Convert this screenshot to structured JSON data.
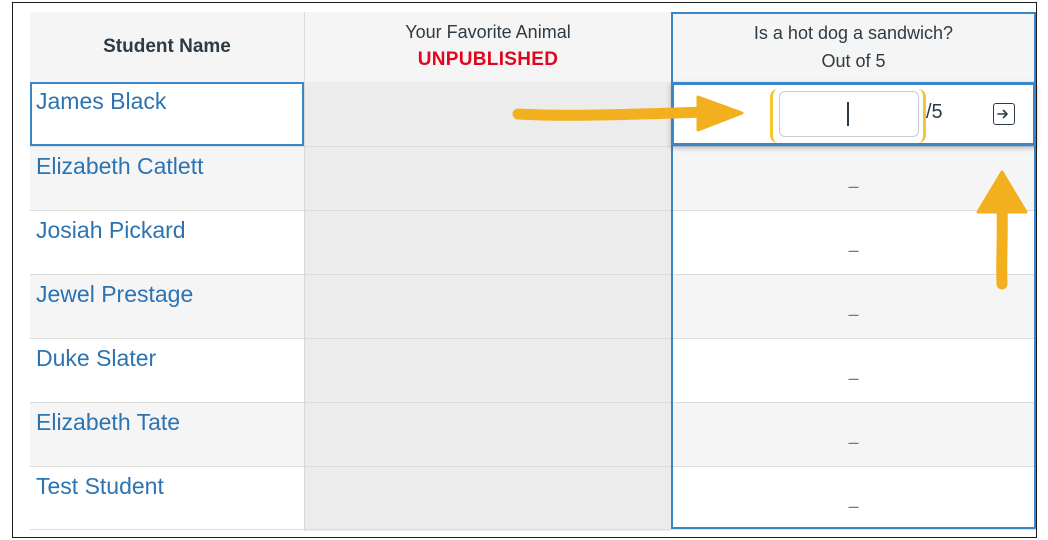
{
  "header": {
    "student_name": "Student Name",
    "animal_title": "Your Favorite Animal",
    "animal_status": "UNPUBLISHED",
    "hotdog_title": "Is a hot dog a sandwich?",
    "hotdog_out_of": "Out of 5"
  },
  "students": [
    {
      "name": "James Black",
      "grade": ""
    },
    {
      "name": "Elizabeth Catlett",
      "grade": "–"
    },
    {
      "name": "Josiah Pickard",
      "grade": "–"
    },
    {
      "name": "Jewel Prestage",
      "grade": "–"
    },
    {
      "name": "Duke Slater",
      "grade": "–"
    },
    {
      "name": "Elizabeth Tate",
      "grade": "–"
    },
    {
      "name": "Test Student",
      "grade": "–"
    }
  ],
  "grade_editor": {
    "value": "",
    "points_possible": "/5"
  },
  "colors": {
    "link": "#2b73b1",
    "unpublished": "#e0061f",
    "active_border": "#3b86c6",
    "annotation_arrow": "#f2b01e"
  },
  "icons": {
    "submit": "arrow-into-box-icon"
  }
}
